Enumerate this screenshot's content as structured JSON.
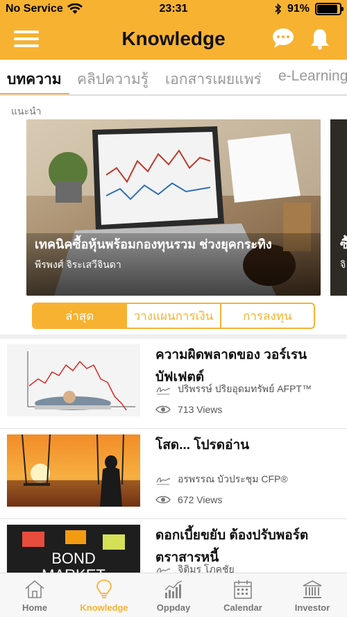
{
  "status_bar": {
    "carrier": "No Service",
    "time": "23:31",
    "battery": "91%",
    "battery_level": 0.91
  },
  "header": {
    "title": "Knowledge"
  },
  "tabs": [
    {
      "label": "บทความ",
      "active": true
    },
    {
      "label": "คลิปความรู้",
      "active": false
    },
    {
      "label": "เอกสารเผยแพร่",
      "active": false
    },
    {
      "label": "e-Learning",
      "active": false
    }
  ],
  "section_label": "แนะนำ",
  "featured": {
    "title": "เทคนิคซื้อหุ้นพร้อมกองทุนรวม ช่วงยุคกระทิง",
    "author": "พีรพงศ์ จิระเสวีจินดา",
    "next_title": "ซื้",
    "next_author": "จิ"
  },
  "segment": [
    {
      "label": "ล่าสุด",
      "active": true
    },
    {
      "label": "วางแผนการเงิน",
      "active": false
    },
    {
      "label": "การลงทุน",
      "active": false
    }
  ],
  "articles": [
    {
      "title": "ความผิดพลาดของ วอร์เรน บัฟเฟตต์",
      "author": "ปริพรรษ์ ปริยอุดมทรัพย์ AFPT™",
      "views": "713 Views"
    },
    {
      "title": "โสด... โปรดอ่าน",
      "author": "อรพรรณ บัวประชุม CFP®",
      "views": "672 Views"
    },
    {
      "title": "ดอกเบี้ยขยับ ต้องปรับพอร์ต ตราสารหนี้",
      "author": "จิติมร โภคชัย",
      "views": "",
      "thumb_text": {
        "bond": "BOND",
        "market": "MARKET"
      }
    }
  ],
  "bottom_nav": [
    {
      "label": "Home",
      "icon": "home-icon",
      "active": false
    },
    {
      "label": "Knowledge",
      "icon": "lightbulb-icon",
      "active": true
    },
    {
      "label": "Oppday",
      "icon": "chart-bars-icon",
      "active": false
    },
    {
      "label": "Calendar",
      "icon": "calendar-icon",
      "active": false
    },
    {
      "label": "Investor",
      "icon": "bank-icon",
      "active": false
    }
  ],
  "colors": {
    "accent": "#f7b232",
    "text": "#111111",
    "muted": "#999999"
  }
}
